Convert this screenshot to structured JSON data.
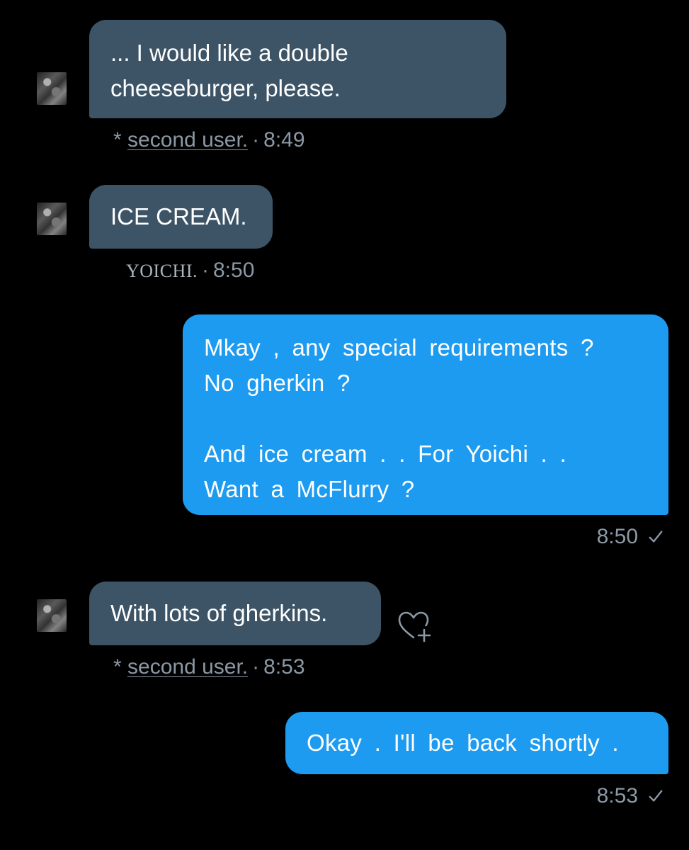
{
  "messages": [
    {
      "lines": [
        "... I would like a double",
        "cheeseburger, please."
      ],
      "meta": {
        "prefix": "* ",
        "sender": "second user.",
        "time": "8:49"
      }
    },
    {
      "lines": [
        "ICE CREAM."
      ],
      "meta": {
        "sender": "YOICHI.",
        "time": "8:50"
      }
    },
    {
      "lines": [
        "Mkay , any special requirements ?",
        "No gherkin ?",
        "",
        "And ice cream . . For Yoichi . .",
        "Want a McFlurry ?"
      ],
      "meta": {
        "time": "8:50"
      }
    },
    {
      "lines": [
        "With lots of gherkins."
      ],
      "meta": {
        "prefix": "* ",
        "sender": "second user.",
        "time": "8:53"
      }
    },
    {
      "lines": [
        "Okay . I'll be back shortly ."
      ],
      "meta": {
        "time": "8:53"
      }
    }
  ],
  "meta_separator": "·",
  "icons": {
    "read_receipt": "check-icon",
    "add_reaction": "heart-plus-icon",
    "avatar": "avatar"
  },
  "colors": {
    "background": "#000000",
    "incoming_bubble": "#3d5466",
    "outgoing_bubble": "#1d9bf0",
    "meta_text": "#8b98a5"
  }
}
